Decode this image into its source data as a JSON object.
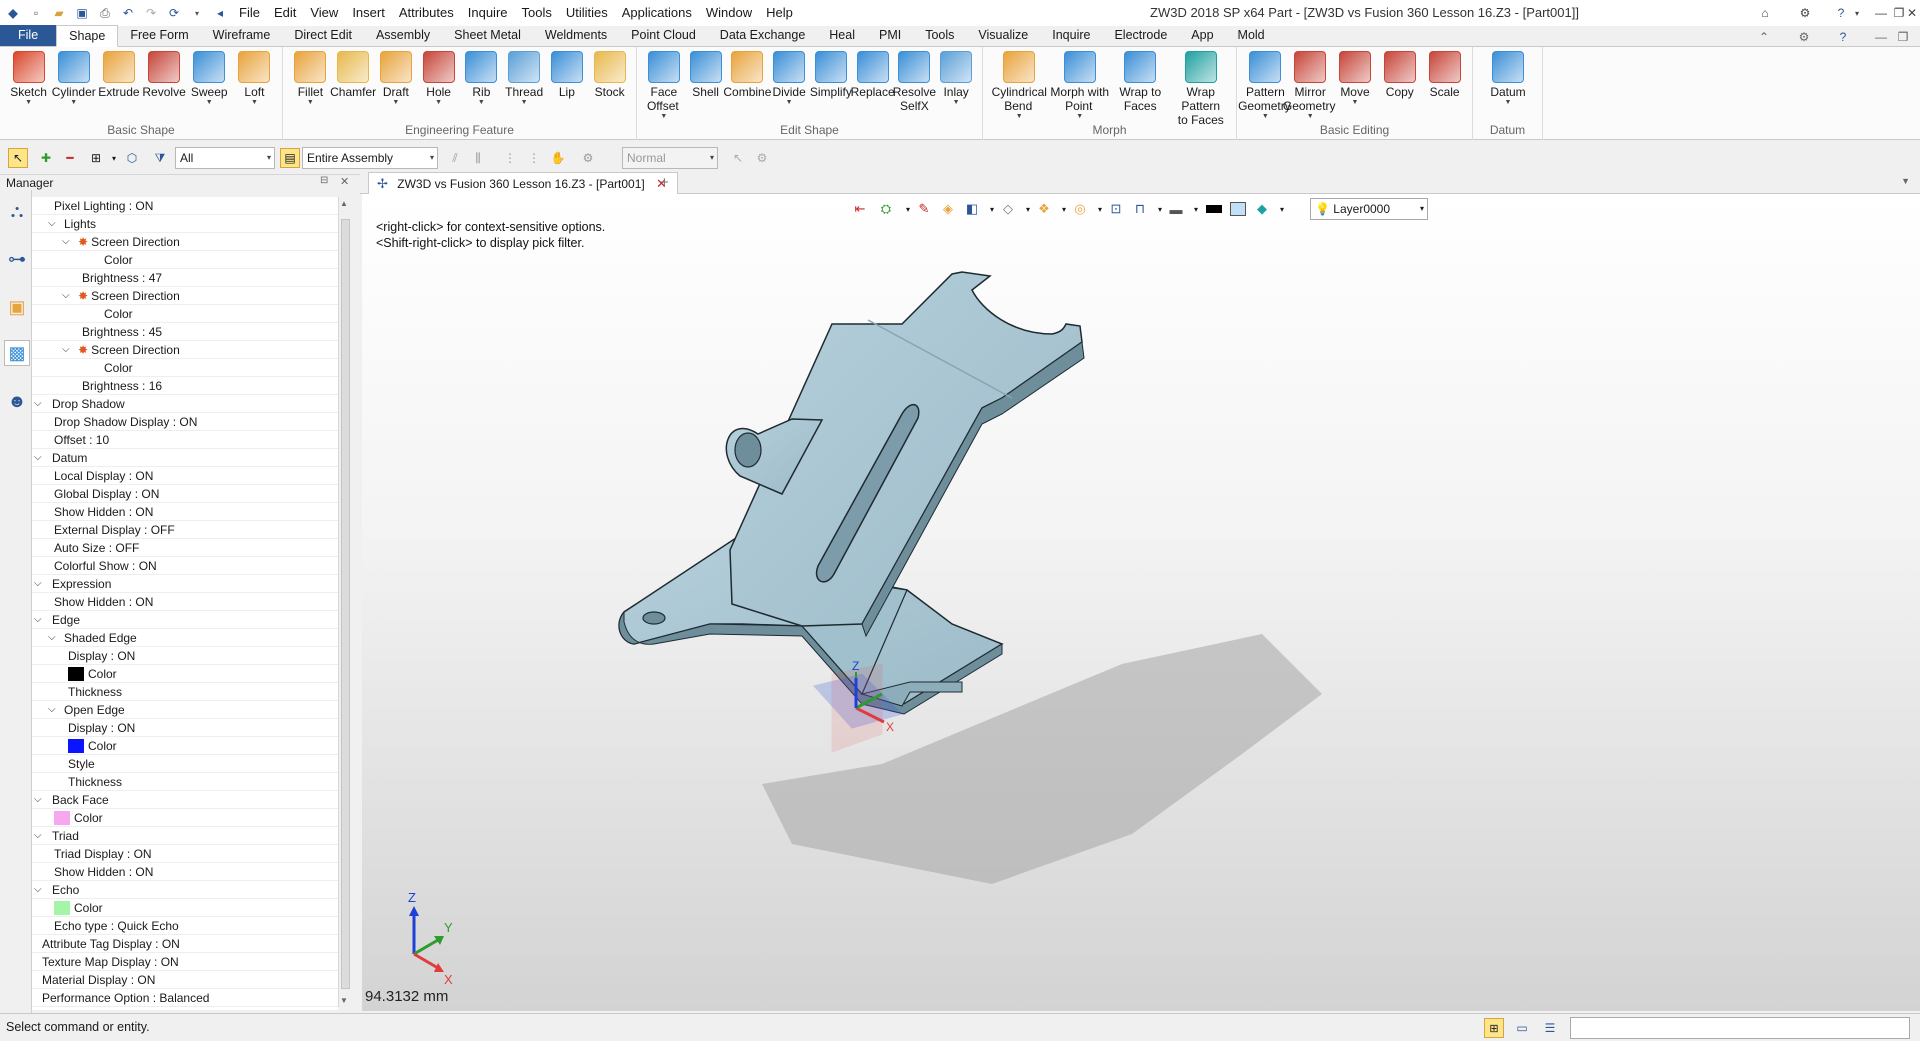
{
  "window": {
    "title": "ZW3D 2018 SP x64        Part - [ZW3D vs Fusion 360 Lesson 16.Z3 - [Part001]]",
    "controls": [
      "⌂",
      "⚙",
      "?",
      "▾",
      "—",
      "❐",
      "✕"
    ]
  },
  "menu": [
    "File",
    "Edit",
    "View",
    "Insert",
    "Attributes",
    "Inquire",
    "Tools",
    "Utilities",
    "Applications",
    "Window",
    "Help"
  ],
  "ribbon_tabs": [
    "File",
    "Shape",
    "Free Form",
    "Wireframe",
    "Direct Edit",
    "Assembly",
    "Sheet Metal",
    "Weldments",
    "Point Cloud",
    "Data Exchange",
    "Heal",
    "PMI",
    "Tools",
    "Visualize",
    "Inquire",
    "Electrode",
    "App",
    "Mold"
  ],
  "ribbon_groups": [
    {
      "label": "Basic Shape",
      "buttons": [
        {
          "label": "Sketch",
          "caret": true,
          "icon": "sketch-icon",
          "color": "#d9472b"
        },
        {
          "label": "Cylinder",
          "caret": true,
          "icon": "cylinder-icon",
          "color": "#3b8fd6"
        },
        {
          "label": "Extrude",
          "caret": false,
          "icon": "extrude-icon",
          "color": "#e8a33c"
        },
        {
          "label": "Revolve",
          "caret": false,
          "icon": "revolve-icon",
          "color": "#c6463a"
        },
        {
          "label": "Sweep",
          "caret": true,
          "icon": "sweep-icon",
          "color": "#3b8fd6"
        },
        {
          "label": "Loft",
          "caret": true,
          "icon": "loft-icon",
          "color": "#e8a33c"
        }
      ]
    },
    {
      "label": "Engineering Feature",
      "buttons": [
        {
          "label": "Fillet",
          "caret": true,
          "icon": "fillet-icon",
          "color": "#e8a33c"
        },
        {
          "label": "Chamfer",
          "caret": false,
          "icon": "chamfer-icon",
          "color": "#e8b84c"
        },
        {
          "label": "Draft",
          "caret": true,
          "icon": "draft-icon",
          "color": "#e8a33c"
        },
        {
          "label": "Hole",
          "caret": true,
          "icon": "hole-icon",
          "color": "#c6463a"
        },
        {
          "label": "Rib",
          "caret": true,
          "icon": "rib-icon",
          "color": "#3b8fd6"
        },
        {
          "label": "Thread",
          "caret": true,
          "icon": "thread-icon",
          "color": "#5b9fd8"
        },
        {
          "label": "Lip",
          "caret": false,
          "icon": "lip-icon",
          "color": "#3b8fd6"
        },
        {
          "label": "Stock",
          "caret": false,
          "icon": "stock-icon",
          "color": "#e8b84c"
        }
      ]
    },
    {
      "label": "Edit Shape",
      "buttons": [
        {
          "label": "Face Offset",
          "label2": "Offset",
          "label1": "Face",
          "caret": true,
          "icon": "face-offset-icon",
          "color": "#3b8fd6"
        },
        {
          "label": "Shell",
          "caret": false,
          "icon": "shell-icon",
          "color": "#3b8fd6"
        },
        {
          "label": "Combine",
          "caret": false,
          "icon": "combine-icon",
          "color": "#e8a33c"
        },
        {
          "label": "Divide",
          "caret": true,
          "icon": "divide-icon",
          "color": "#3b8fd6"
        },
        {
          "label": "Simplify",
          "caret": false,
          "icon": "simplify-icon",
          "color": "#3b8fd6"
        },
        {
          "label": "Replace",
          "caret": false,
          "icon": "replace-icon",
          "color": "#3b8fd6"
        },
        {
          "label": "Resolve SelfX",
          "label1": "Resolve",
          "label2": "SelfX",
          "caret": false,
          "icon": "resolve-selfx-icon",
          "color": "#3b8fd6"
        },
        {
          "label": "Inlay",
          "caret": true,
          "icon": "inlay-icon",
          "color": "#5b9fd8"
        }
      ]
    },
    {
      "label": "Morph",
      "buttons": [
        {
          "label": "Cylindrical Bend",
          "label1": "Cylindrical",
          "label2": "Bend",
          "caret": true,
          "icon": "cylindrical-bend-icon",
          "color": "#e8a33c"
        },
        {
          "label": "Morph with Point",
          "label1": "Morph with",
          "label2": "Point",
          "caret": true,
          "icon": "morph-point-icon",
          "color": "#3b8fd6"
        },
        {
          "label": "Wrap to Faces",
          "label1": "Wrap to",
          "label2": "Faces",
          "caret": false,
          "icon": "wrap-faces-icon",
          "color": "#3b8fd6"
        },
        {
          "label": "Wrap Pattern to Faces",
          "label1": "Wrap Pattern",
          "label2": "to Faces",
          "caret": false,
          "icon": "wrap-pattern-icon",
          "color": "#20a0a0"
        }
      ]
    },
    {
      "label": "Basic Editing",
      "buttons": [
        {
          "label": "Pattern Geometry",
          "label1": "Pattern",
          "label2": "Geometry",
          "caret": true,
          "icon": "pattern-icon",
          "color": "#3b8fd6"
        },
        {
          "label": "Mirror Geometry",
          "label1": "Mirror",
          "label2": "Geometry",
          "caret": true,
          "icon": "mirror-icon",
          "color": "#c6463a"
        },
        {
          "label": "Move",
          "caret": true,
          "icon": "move-icon",
          "color": "#c6463a"
        },
        {
          "label": "Copy",
          "caret": false,
          "icon": "copy-icon",
          "color": "#c6463a"
        },
        {
          "label": "Scale",
          "caret": false,
          "icon": "scale-icon",
          "color": "#c6463a"
        }
      ]
    },
    {
      "label": "Datum",
      "buttons": [
        {
          "label": "Datum",
          "caret": true,
          "icon": "datum-icon",
          "color": "#3b8fd6"
        }
      ]
    }
  ],
  "toolrow": {
    "filter_value": "All",
    "assembly_value": "Entire Assembly",
    "mode_value": "Normal"
  },
  "manager": {
    "title": "Manager",
    "tree": [
      {
        "level": 1,
        "text": "Pixel Lighting : ON"
      },
      {
        "level": 1,
        "text": "Lights",
        "expand": true
      },
      {
        "level": 2,
        "text": "Screen Direction",
        "expand": true,
        "icon": true
      },
      {
        "level": 4,
        "text": "Color"
      },
      {
        "level": 3,
        "text": "Brightness : 47"
      },
      {
        "level": 2,
        "text": "Screen Direction",
        "expand": true,
        "icon": true
      },
      {
        "level": 4,
        "text": "Color"
      },
      {
        "level": 3,
        "text": "Brightness : 45"
      },
      {
        "level": 2,
        "text": "Screen Direction",
        "expand": true,
        "icon": true
      },
      {
        "level": 4,
        "text": "Color"
      },
      {
        "level": 3,
        "text": "Brightness : 16"
      },
      {
        "level": 0,
        "text": "Drop Shadow",
        "expand": true
      },
      {
        "level": 1,
        "text": "Drop Shadow Display : ON"
      },
      {
        "level": 1,
        "text": "Offset : 10"
      },
      {
        "level": 0,
        "text": "Datum",
        "expand": true
      },
      {
        "level": 1,
        "text": "Local Display : ON"
      },
      {
        "level": 1,
        "text": "Global Display : ON"
      },
      {
        "level": 1,
        "text": "Show Hidden : ON"
      },
      {
        "level": 1,
        "text": "External Display : OFF"
      },
      {
        "level": 1,
        "text": "Auto Size : OFF"
      },
      {
        "level": 1,
        "text": "Colorful Show : ON"
      },
      {
        "level": 0,
        "text": "Expression",
        "expand": true
      },
      {
        "level": 1,
        "text": "Show Hidden : ON"
      },
      {
        "level": 0,
        "text": "Edge",
        "expand": true
      },
      {
        "level": 1,
        "text": "Shaded Edge",
        "expand": true
      },
      {
        "level": 2,
        "text": "Display : ON"
      },
      {
        "level": 2,
        "text": "Color",
        "swatch": "#000000"
      },
      {
        "level": 2,
        "text": "Thickness"
      },
      {
        "level": 1,
        "text": "Open Edge",
        "expand": true
      },
      {
        "level": 2,
        "text": "Display : ON"
      },
      {
        "level": 2,
        "text": "Color",
        "swatch": "#0a14ff"
      },
      {
        "level": 2,
        "text": "Style"
      },
      {
        "level": 2,
        "text": "Thickness"
      },
      {
        "level": 0,
        "text": "Back Face",
        "expand": true
      },
      {
        "level": 1,
        "text": "Color",
        "swatch": "#f7a6f0"
      },
      {
        "level": 0,
        "text": "Triad",
        "expand": true
      },
      {
        "level": 1,
        "text": "Triad Display : ON"
      },
      {
        "level": 1,
        "text": "Show Hidden : ON"
      },
      {
        "level": 0,
        "text": "Echo",
        "expand": true
      },
      {
        "level": 1,
        "text": "Color",
        "swatch": "#a6f5a6"
      },
      {
        "level": 1,
        "text": "Echo type : Quick Echo"
      },
      {
        "level": 0,
        "text": "Attribute Tag Display : ON"
      },
      {
        "level": 0,
        "text": "Texture Map Display : ON"
      },
      {
        "level": 0,
        "text": "Material Display : ON"
      },
      {
        "level": 0,
        "text": "Performance Option : Balanced"
      }
    ]
  },
  "document": {
    "tab_label": "ZW3D vs Fusion 360 Lesson 16.Z3 - [Part001]",
    "layer": "Layer0000",
    "hint1": "<right-click> for context-sensitive options.",
    "hint2": "<Shift-right-click> to display pick filter.",
    "scale": "94.3132 mm",
    "axis_x": "X",
    "axis_y": "Y",
    "axis_z": "Z"
  },
  "status": {
    "text": "Select command or entity."
  },
  "colors": {
    "part_face": "#a9c6d2",
    "part_side": "#6e8e9c",
    "file_tab": "#2b5797"
  }
}
